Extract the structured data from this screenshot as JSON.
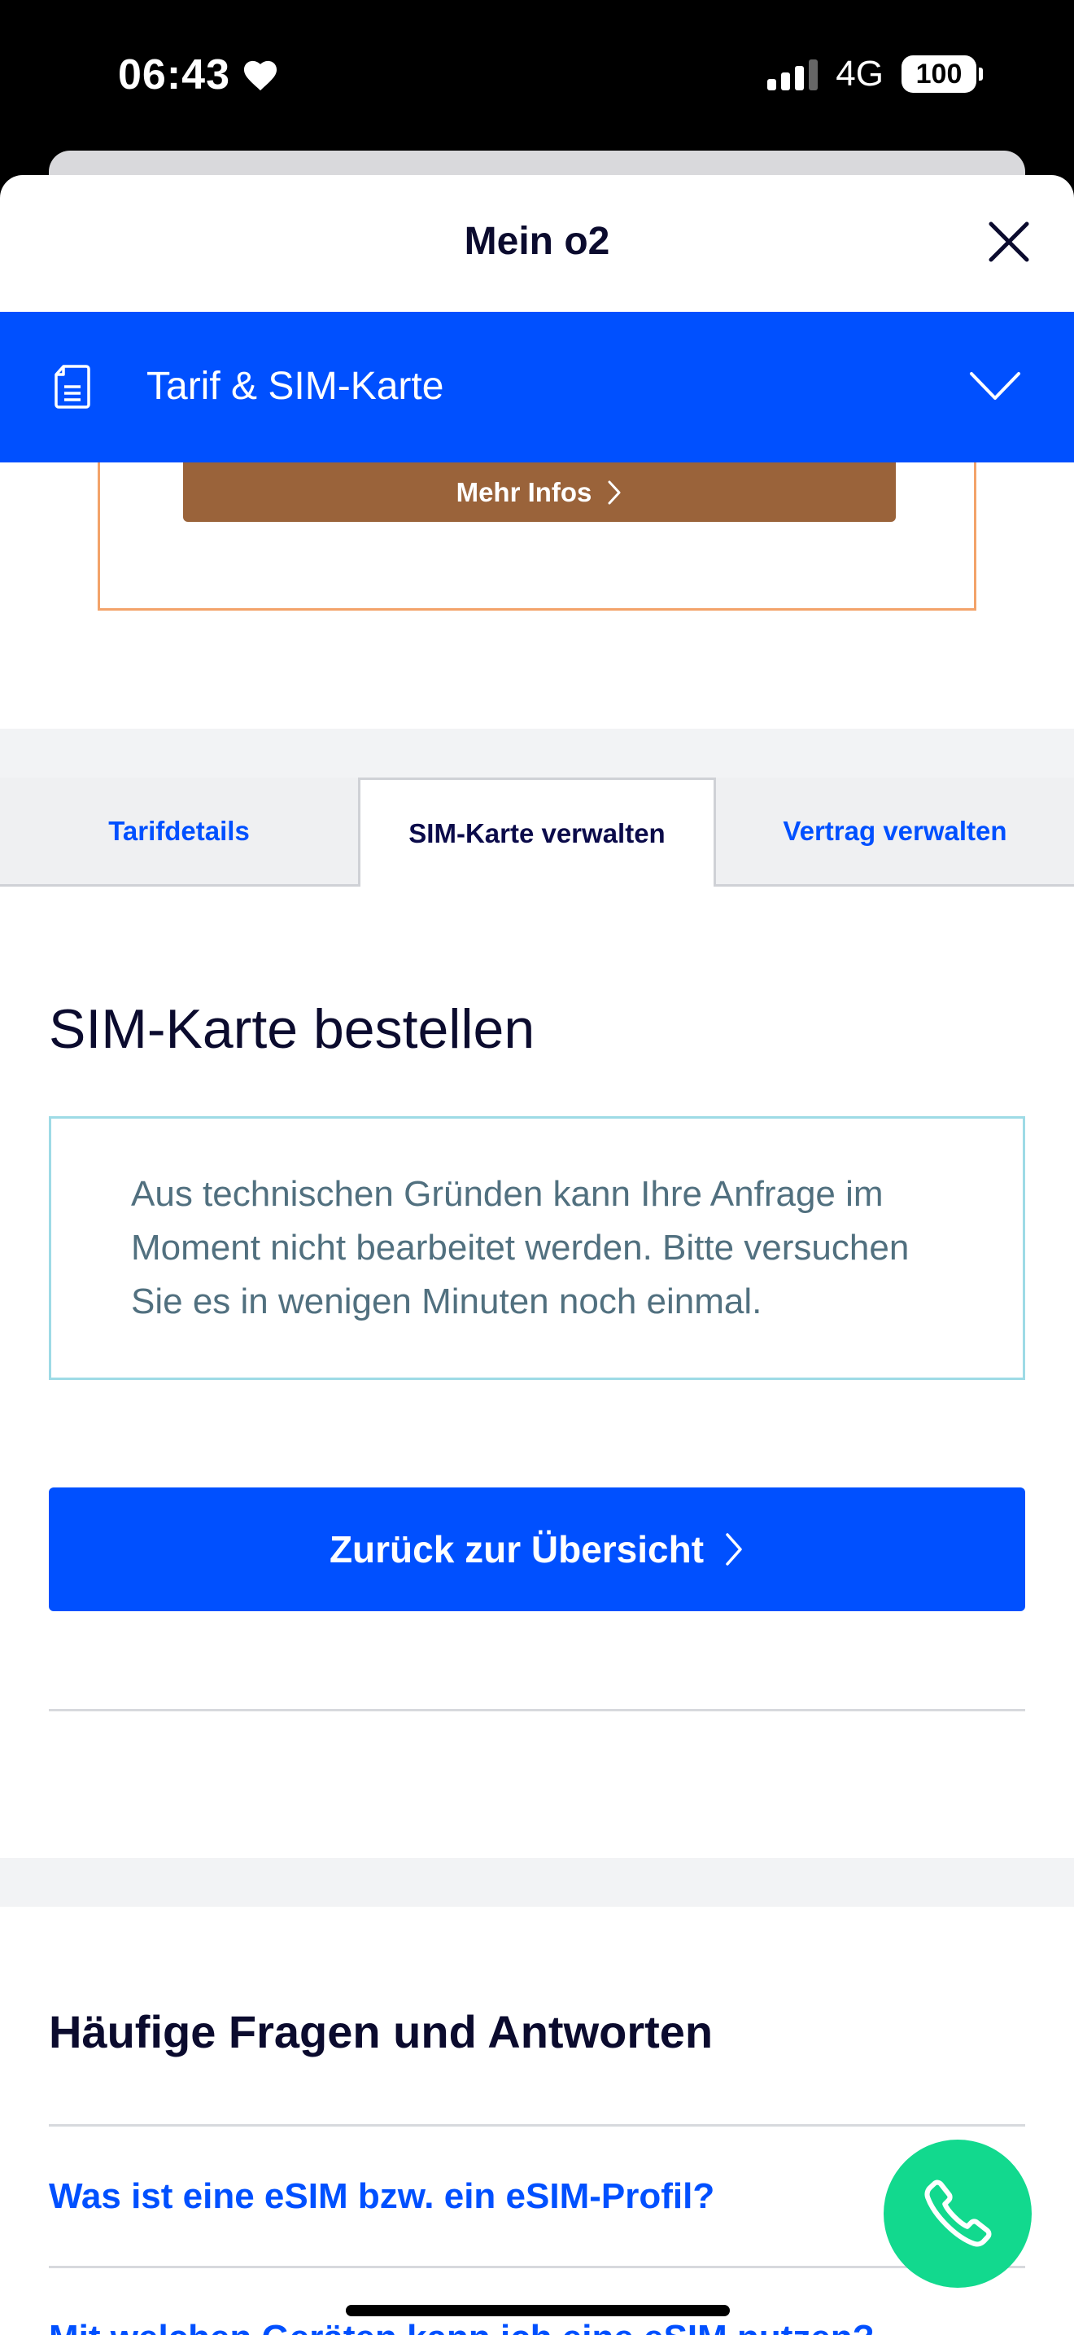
{
  "status_bar": {
    "time": "06:43",
    "network": "4G",
    "battery": "100"
  },
  "sheet": {
    "title": "Mein o2"
  },
  "section_bar": {
    "label": "Tarif & SIM-Karte"
  },
  "promo": {
    "button_label": "Mehr Infos"
  },
  "tabs": [
    {
      "label": "Tarifdetails",
      "active": false
    },
    {
      "label": "SIM-Karte verwalten",
      "active": true
    },
    {
      "label": "Vertrag verwalten",
      "active": false
    }
  ],
  "main": {
    "heading": "SIM-Karte bestellen",
    "notice": "Aus technischen Gründen kann Ihre Anfrage im Moment nicht bearbeitet werden. Bitte versuchen Sie es in wenigen Minuten noch einmal.",
    "back_button": "Zurück zur Übersicht"
  },
  "faq": {
    "title": "Häufige Fragen und Antworten",
    "items": [
      "Was ist eine eSIM bzw. ein eSIM-Profil?",
      "Mit welchen Geräten kann ich eine eSIM nutzen?"
    ]
  },
  "colors": {
    "brand_blue": "#0050ff",
    "call_fab": "#12d98e",
    "promo_brown": "#9a633a"
  }
}
